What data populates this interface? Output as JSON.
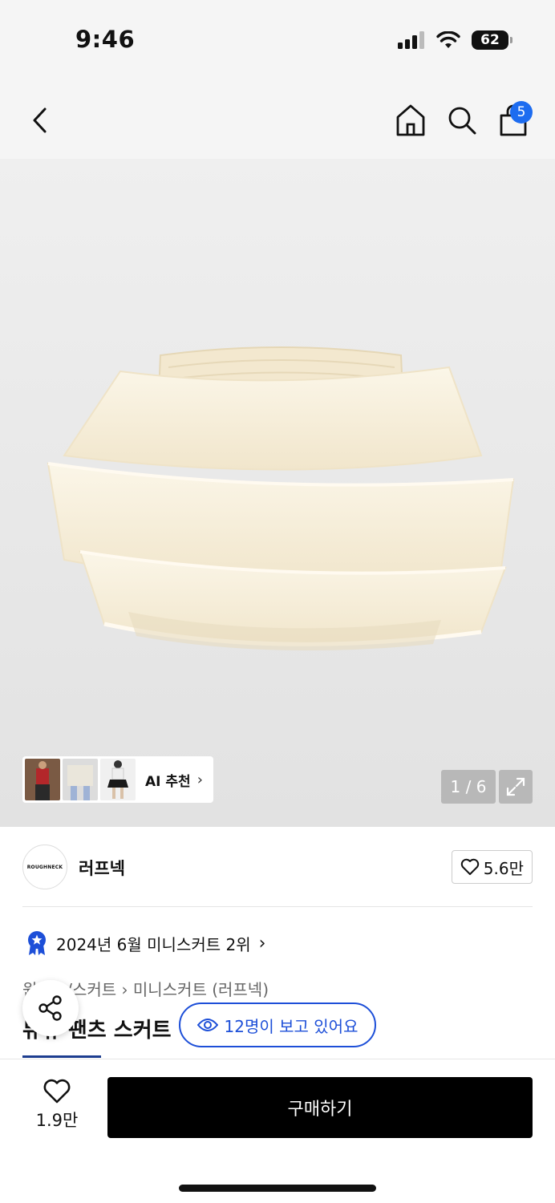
{
  "status_bar": {
    "time": "9:46",
    "battery": "62"
  },
  "nav": {
    "cart_badge": "5"
  },
  "gallery": {
    "ai_label": "AI 추천",
    "page_counter": "1 / 6"
  },
  "brand": {
    "logo_text": "ROUGHNECK",
    "name": "러프넥",
    "likes": "5.6만"
  },
  "ranking": {
    "text": "2024년 6월 미니스커트 2위"
  },
  "breadcrumb": "원피스/스커트 › 미니스커트 (러프넥)",
  "product": {
    "title": "뮤뮤 팬츠 스커트"
  },
  "viewers": {
    "text": "12명이 보고 있어요"
  },
  "bottom": {
    "wish_count": "1.9만",
    "buy_label": "구매하기"
  },
  "colors": {
    "accent": "#1d4fd8",
    "badge": "#1d6cf0",
    "buy_button": "#000000"
  }
}
